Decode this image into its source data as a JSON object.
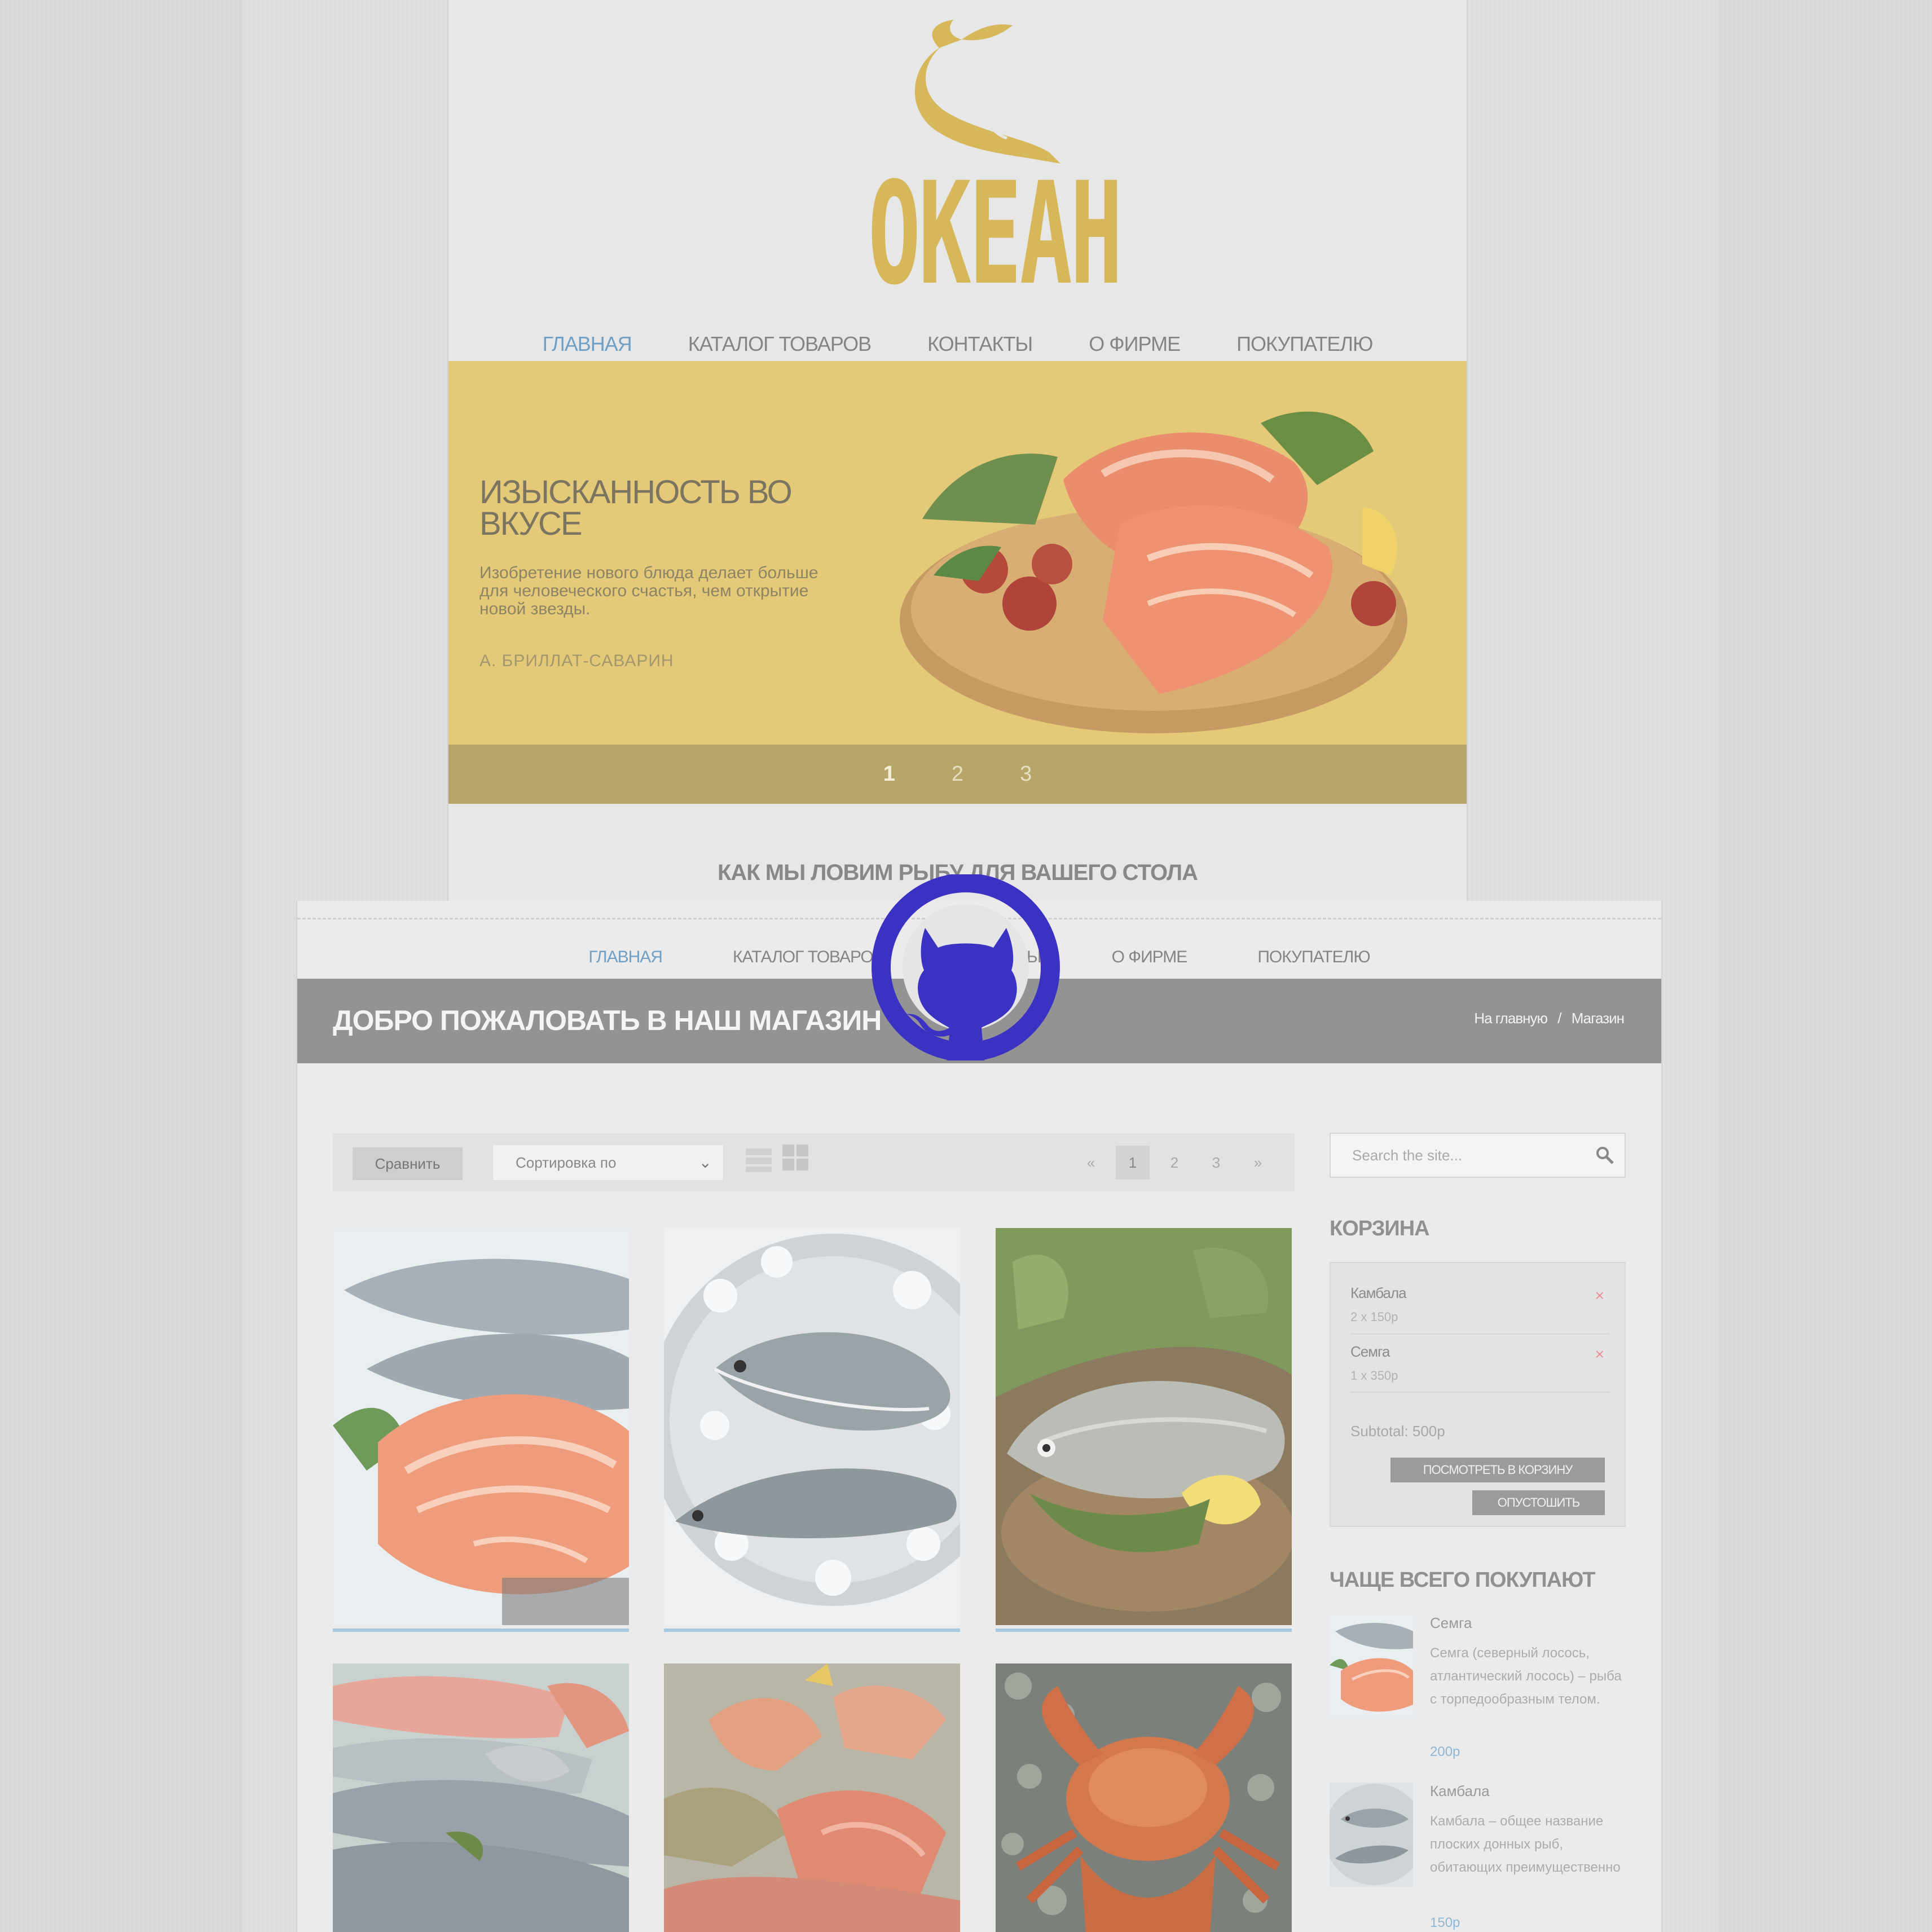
{
  "colors": {
    "accent_blue": "#6f9fc4",
    "hero_yellow": "#e4c978",
    "logo_gold": "#d6b75a",
    "github_purple": "#3b32c3",
    "band_gray": "#939393"
  },
  "homepage": {
    "logo_text": "ОКЕАН",
    "nav": [
      {
        "label": "ГЛАВНАЯ",
        "active": true
      },
      {
        "label": "КАТАЛОГ ТОВАРОВ"
      },
      {
        "label": "КОНТАКТЫ"
      },
      {
        "label": "О ФИРМЕ"
      },
      {
        "label": "ПОКУПАТЕЛЮ"
      }
    ],
    "hero": {
      "title": "ИЗЫСКАННОСТЬ ВО ВКУСЕ",
      "quote": "Изобретение нового блюда делает больше для человеческого счастья, чем открытие новой звезды.",
      "author": "А. БРИЛЛАТ-САВАРИН"
    },
    "slider": [
      "1",
      "2",
      "3"
    ],
    "section_title": "КАК МЫ ЛОВИМ РЫБУ ДЛЯ ВАШЕГО СТОЛА"
  },
  "shop": {
    "nav": [
      {
        "label": "ГЛАВНАЯ",
        "active": true
      },
      {
        "label": "КАТАЛОГ ТОВАРОВ"
      },
      {
        "label": "КОНТАКТЫ"
      },
      {
        "label": "О ФИРМЕ"
      },
      {
        "label": "ПОКУПАТЕЛЮ"
      }
    ],
    "page_title": "ДОБРО ПОЖАЛОВАТЬ В НАШ МАГАЗИН",
    "breadcrumb": {
      "home": "На главную",
      "separator": "/",
      "current": "Магазин"
    },
    "toolbar": {
      "compare_label": "Сравнить",
      "sort_value": "Сортировка по",
      "pager": [
        "«",
        "1",
        "2",
        "3",
        "»"
      ],
      "pager_active": "1"
    },
    "search": {
      "placeholder": "Search the site..."
    },
    "cart": {
      "title": "КОРЗИНА",
      "items": [
        {
          "name": "Камбала",
          "qty": "2 x 150р"
        },
        {
          "name": "Семга",
          "qty": "1 x 350р"
        }
      ],
      "subtotal": "Subtotal: 500р",
      "view_cart": "ПОСМОТРЕТЬ В КОРЗИНУ",
      "empty_cart": "ОПУСТОШИТЬ"
    },
    "popular": {
      "title": "ЧАЩЕ ВСЕГО ПОКУПАЮТ",
      "items": [
        {
          "name": "Семга",
          "desc": "Семга (северный лосось, атлантический лосось) – рыба с торпедообразным телом.",
          "price": "200р"
        },
        {
          "name": "Камбала",
          "desc": "Камбала – общее название плоских донных рыб, обитающих преимущественно",
          "price": "150р"
        }
      ]
    }
  }
}
